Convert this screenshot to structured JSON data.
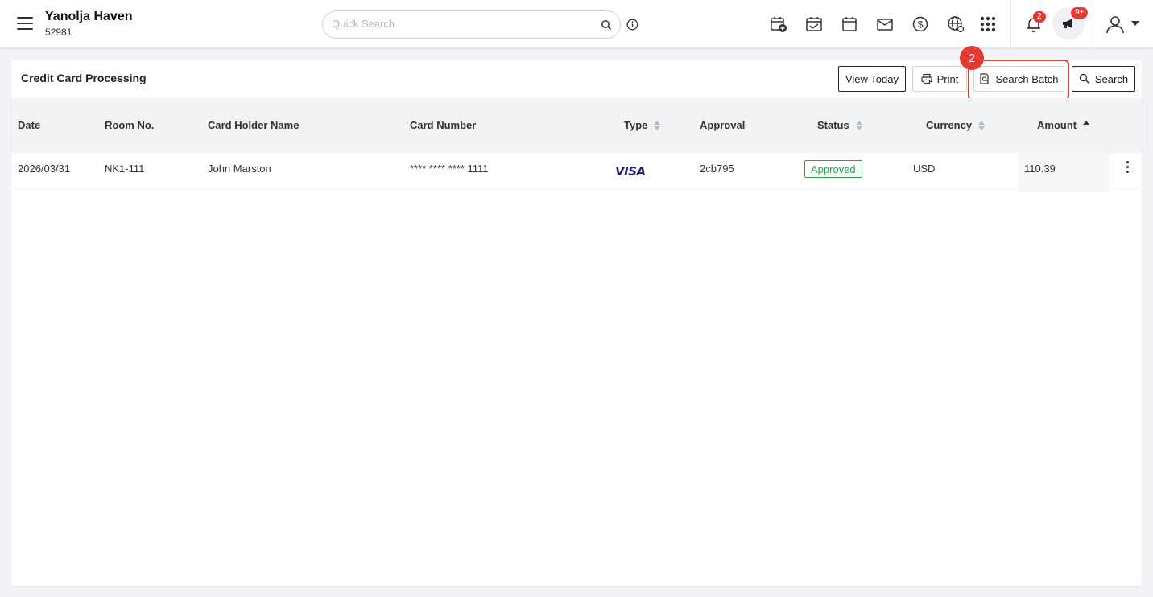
{
  "header": {
    "hotel_name": "Yanolja Haven",
    "hotel_id": "52981",
    "search_placeholder": "Quick Search",
    "notification_count": "2",
    "announcement_count": "9+"
  },
  "icons": [
    "menu-icon",
    "search-icon",
    "info-icon",
    "calendar-add-icon",
    "calendar-check-icon",
    "calendar-icon",
    "mail-icon",
    "dollar-icon",
    "globe-icon",
    "apps-grid-icon",
    "bell-icon",
    "megaphone-icon",
    "user-icon",
    "caret-down-icon",
    "print-icon",
    "search-batch-icon",
    "visa-logo",
    "kebab-menu-icon"
  ],
  "panel": {
    "title": "Credit Card Processing",
    "buttons": {
      "view_today": "View Today",
      "print": "Print",
      "search_batch": "Search Batch",
      "search": "Search"
    },
    "step_number": "2"
  },
  "table": {
    "columns": [
      "Date",
      "Room No.",
      "Card Holder Name",
      "Card Number",
      "Type",
      "Approval",
      "Status",
      "Currency",
      "Amount"
    ],
    "rows": [
      {
        "date": "2026/03/31",
        "room": "NK1-111",
        "holder": "John Marston",
        "card": "**** **** **** 1111",
        "type": "VISA",
        "approval": "2cb795",
        "status": "Approved",
        "currency": "USD",
        "amount": "110.39"
      }
    ]
  },
  "colors": {
    "accent_red": "#e53935",
    "approved_green": "#2e9b4e",
    "visa_blue": "#1a1f71"
  }
}
